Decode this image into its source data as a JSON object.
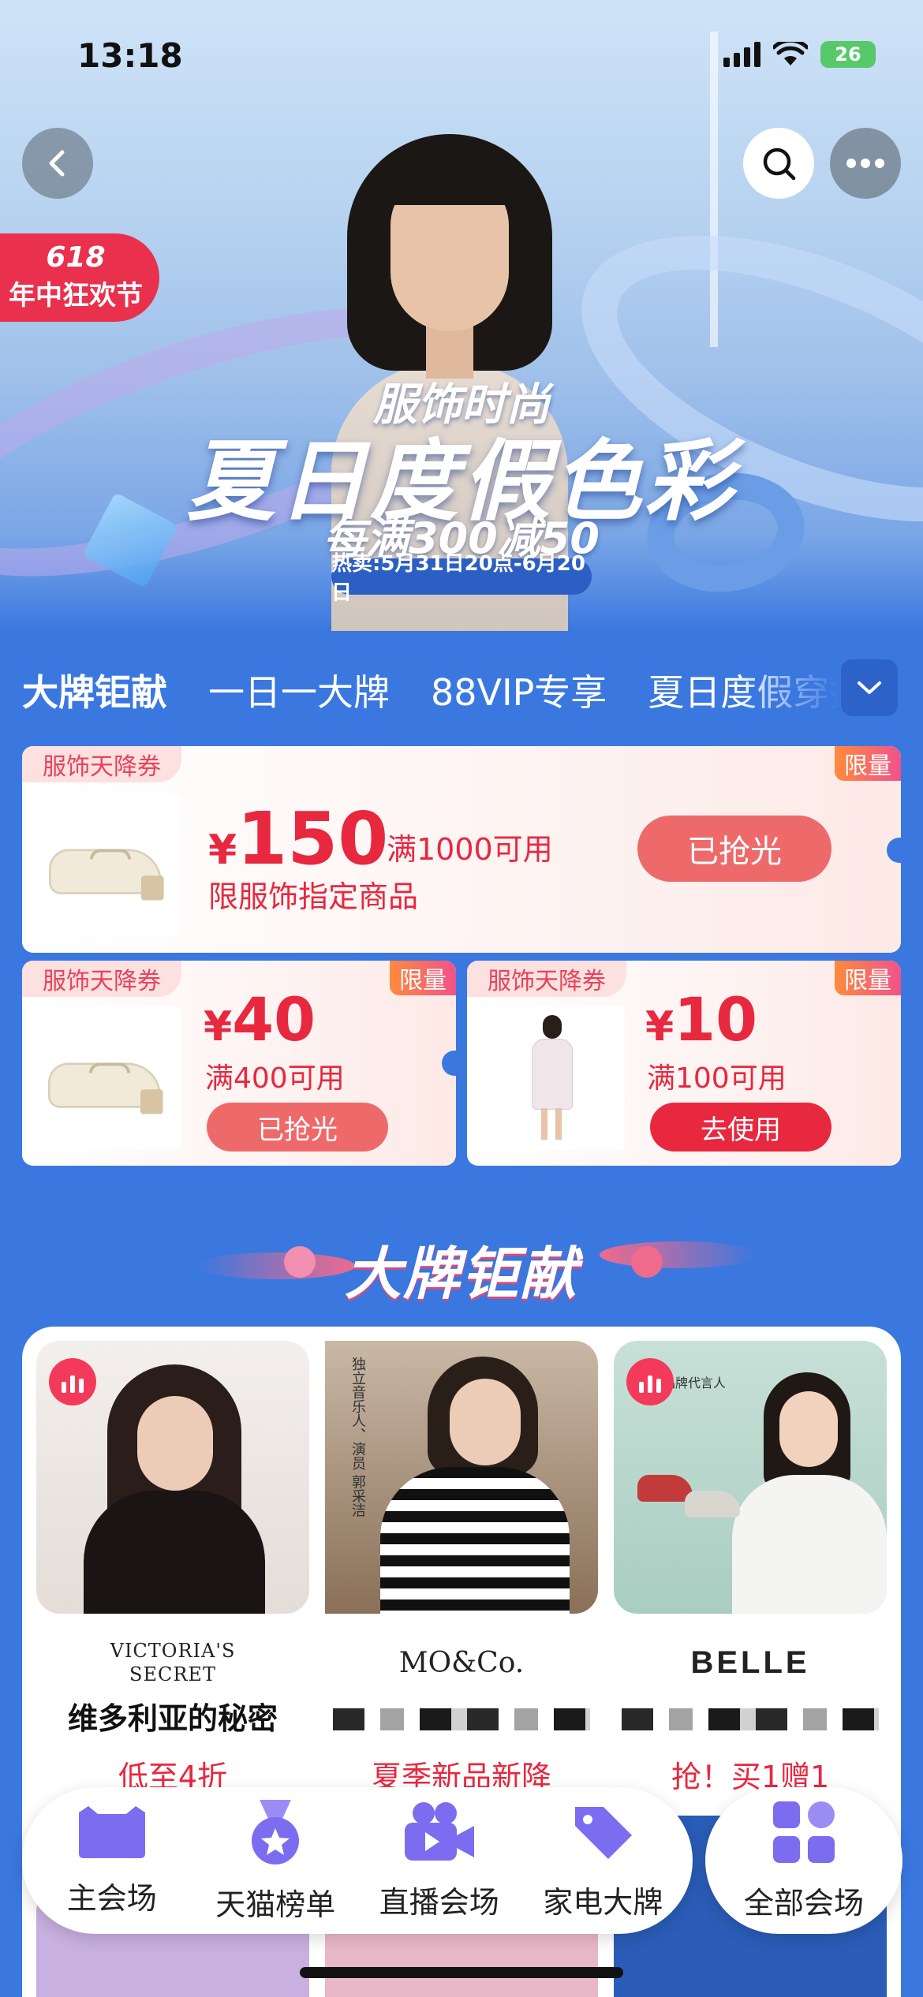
{
  "status_bar": {
    "time": "13:18",
    "battery": "26"
  },
  "hero": {
    "badge_number": "618",
    "badge_text": "年中狂欢节",
    "subtitle": "服饰时尚",
    "title": "夏日度假色彩",
    "promo": "每满300减50",
    "date": "热卖:5月31日20点-6月20日"
  },
  "tabs": [
    "大牌钜献",
    "一日一大牌",
    "88VIP专享",
    "夏日度假穿搭"
  ],
  "coupons": {
    "big": {
      "tag": "服饰天降券",
      "limit": "限量",
      "currency": "¥",
      "amount": "150",
      "condition": "满1000可用",
      "desc": "限服饰指定商品",
      "button": "已抢光"
    },
    "left": {
      "tag": "服饰天降券",
      "limit": "限量",
      "currency": "¥",
      "amount": "40",
      "condition": "满400可用",
      "button": "已抢光"
    },
    "right": {
      "tag": "服饰天降券",
      "limit": "限量",
      "currency": "¥",
      "amount": "10",
      "condition": "满100可用",
      "button": "去使用"
    }
  },
  "section_title": "大牌钜献",
  "brands": [
    {
      "logo": "VICTORIA'S SECRET",
      "name": "维多利亚的秘密",
      "promo": "低至4折"
    },
    {
      "logo": "MO&Co.",
      "caption": "独立音乐人、演员 郭采洁",
      "promo": "夏季新品新降"
    },
    {
      "logo": "BELLE",
      "caption": "百丽品牌代言人",
      "promo": "抢！买1赠1"
    }
  ],
  "bottom_nav": [
    "主会场",
    "天猫榜单",
    "直播会场",
    "家电大牌"
  ],
  "bottom_nav_all": "全部会场",
  "colors": {
    "accent_red": "#e8283f",
    "bg_blue": "#3a78e0",
    "nav_purple": "#7b6cf0"
  }
}
